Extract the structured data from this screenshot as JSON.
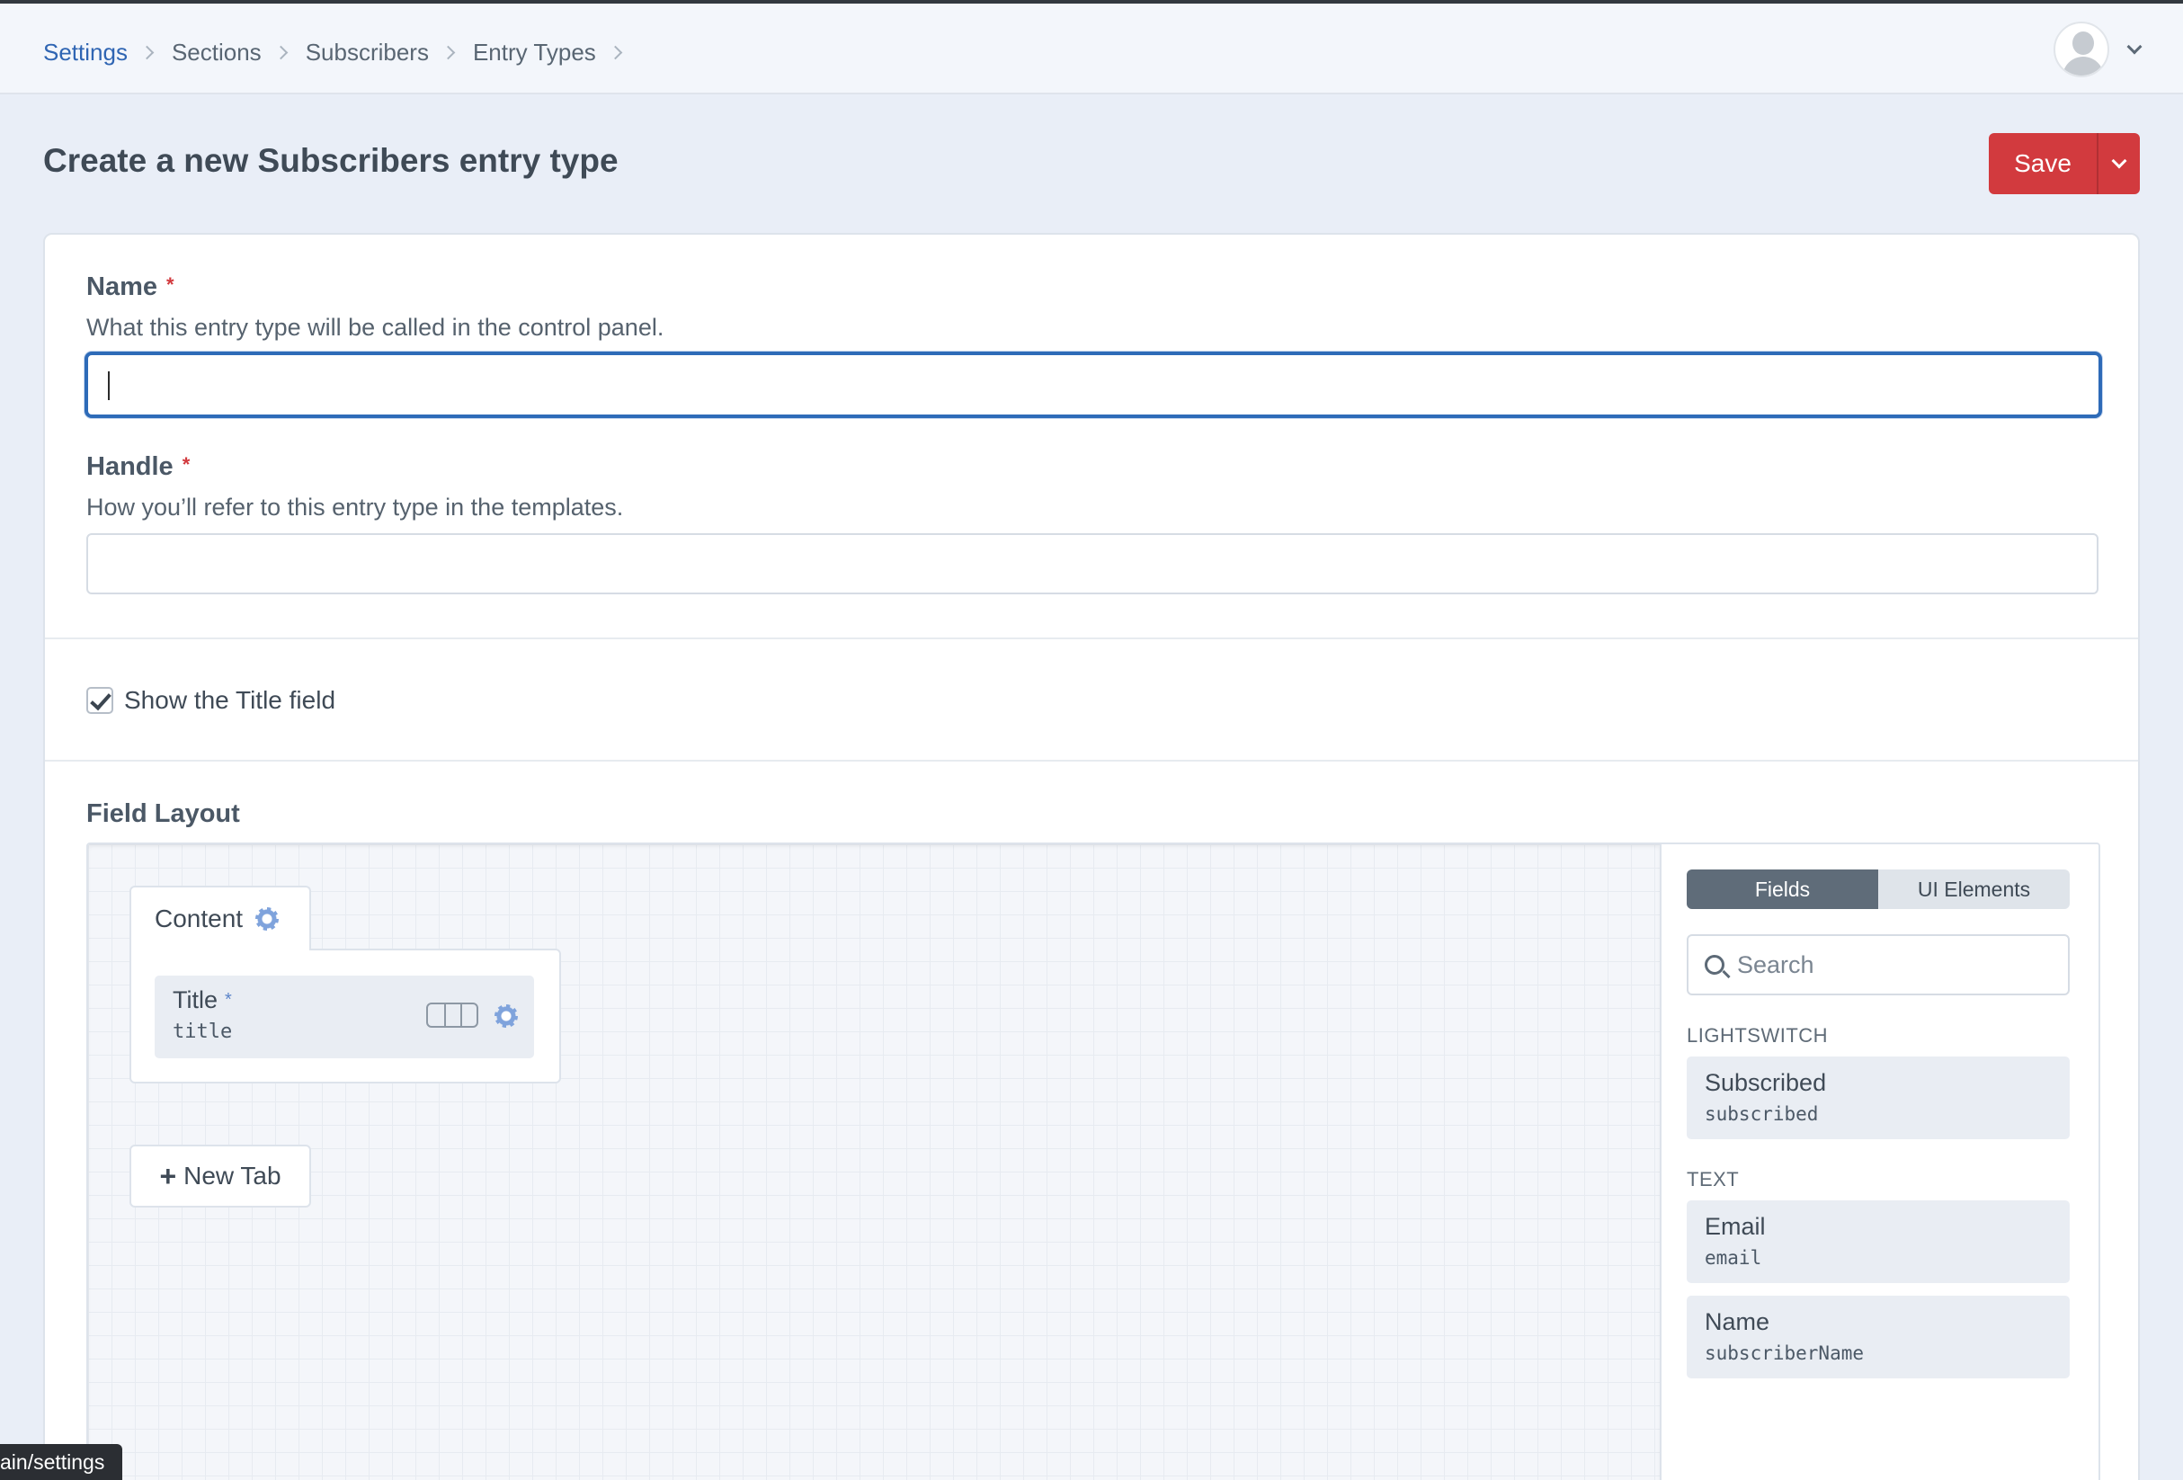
{
  "breadcrumb": {
    "items": [
      {
        "label": "Settings"
      },
      {
        "label": "Sections"
      },
      {
        "label": "Subscribers"
      },
      {
        "label": "Entry Types"
      }
    ]
  },
  "page": {
    "title": "Create a new Subscribers entry type",
    "save_label": "Save"
  },
  "form": {
    "name_label": "Name",
    "name_required": "*",
    "name_hint": "What this entry type will be called in the control panel.",
    "name_value": "",
    "handle_label": "Handle",
    "handle_required": "*",
    "handle_hint": "How you’ll refer to this entry type in the templates.",
    "handle_value": "",
    "show_title_label": "Show the Title field",
    "show_title_checked": true,
    "field_layout_label": "Field Layout"
  },
  "designer": {
    "tab": {
      "name": "Content",
      "fields": [
        {
          "name": "Title",
          "required": "*",
          "handle": "title"
        }
      ]
    },
    "new_tab_label": "New Tab",
    "plus_glyph": "+",
    "library": {
      "tabs": [
        {
          "label": "Fields",
          "active": true
        },
        {
          "label": "UI Elements",
          "active": false
        }
      ],
      "search_placeholder": "Search",
      "groups": [
        {
          "header": "LIGHTSWITCH",
          "fields": [
            {
              "name": "Subscribed",
              "handle": "subscribed"
            }
          ]
        },
        {
          "header": "TEXT",
          "fields": [
            {
              "name": "Email",
              "handle": "email"
            },
            {
              "name": "Name",
              "handle": "subscriberName"
            }
          ]
        }
      ]
    }
  },
  "status_bar": {
    "url_tip": "ain/settings"
  },
  "colors": {
    "accent": "#2f65b3",
    "save": "#d23a3e",
    "focus_ring": "#2e6bb8",
    "gear": "#7fa3dc"
  },
  "icons": {
    "breadcrumb_separator": "chevron-right-icon",
    "user_menu": "chevron-down-icon",
    "save_menu": "chevron-down-icon",
    "tab_settings": "gear-icon",
    "field_width": "field-width-icon",
    "field_settings": "gear-icon",
    "search": "search-icon",
    "checkbox": "checkmark-icon"
  }
}
